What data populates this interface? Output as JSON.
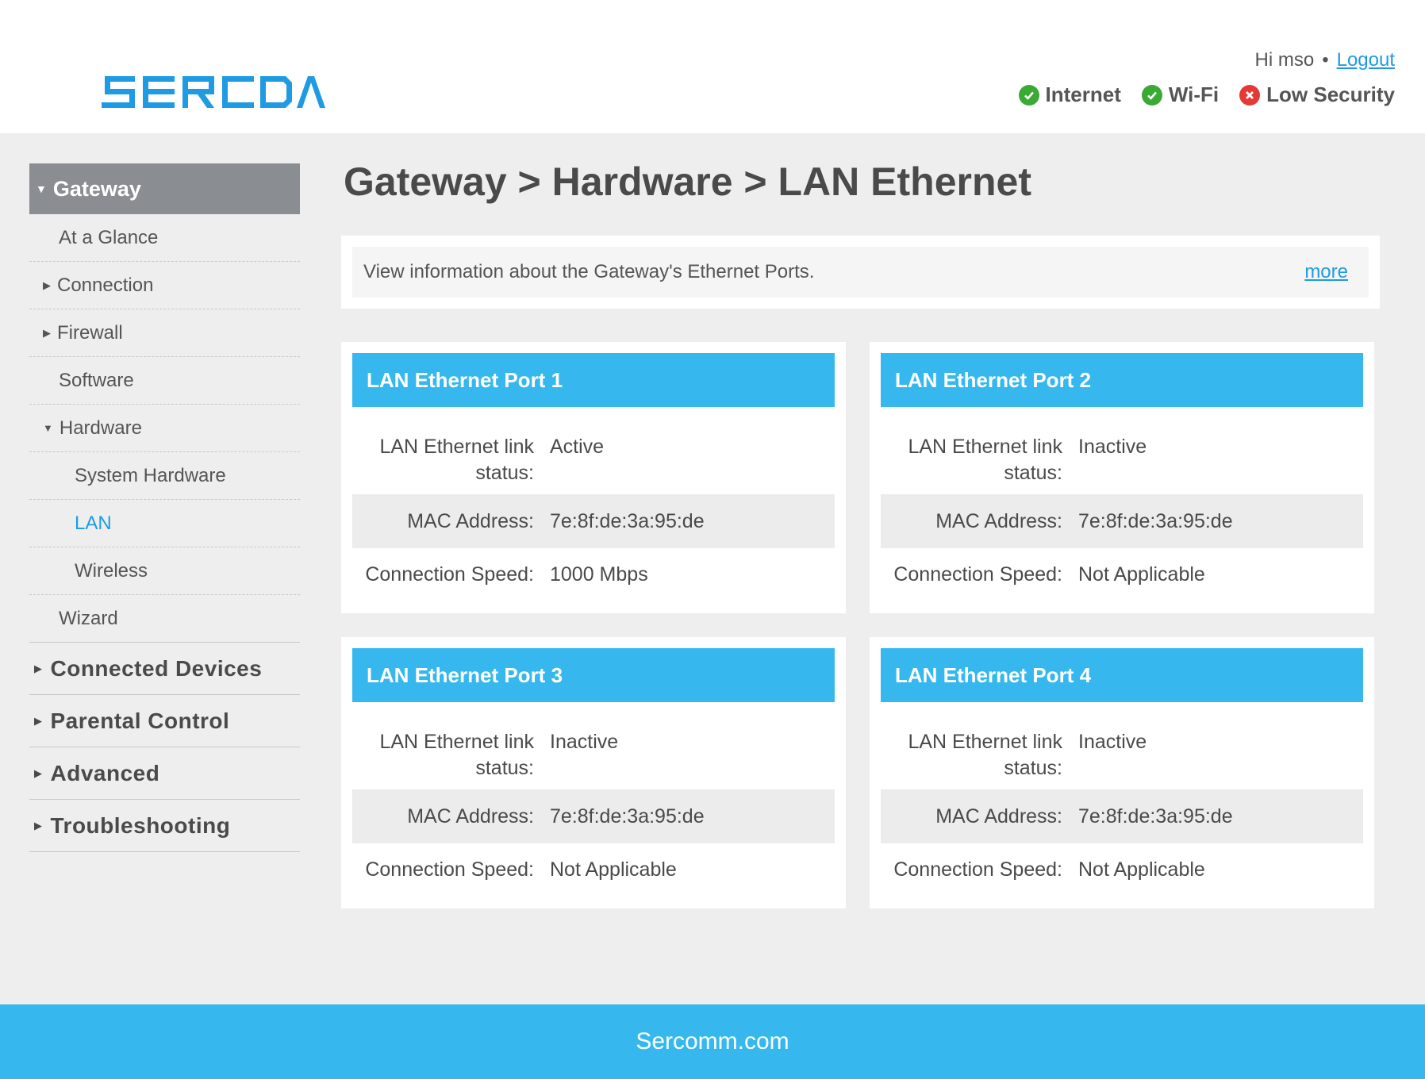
{
  "header": {
    "logo_text": "SERCOMM",
    "greeting": "Hi mso",
    "logout": "Logout",
    "status": [
      {
        "label": "Internet",
        "state": "ok"
      },
      {
        "label": "Wi-Fi",
        "state": "ok"
      },
      {
        "label": "Low Security",
        "state": "error"
      }
    ],
    "colors": {
      "ok": "#3aaa35",
      "error": "#e53935",
      "brand": "#1e9be2"
    }
  },
  "sidebar": {
    "section": "Gateway",
    "items": [
      {
        "label": "At a Glance"
      },
      {
        "label": "Connection"
      },
      {
        "label": "Firewall"
      },
      {
        "label": "Software"
      },
      {
        "label": "Hardware"
      },
      {
        "label": "System Hardware"
      },
      {
        "label": "LAN"
      },
      {
        "label": "Wireless"
      },
      {
        "label": "Wizard"
      }
    ],
    "top_items": [
      "Connected Devices",
      "Parental Control",
      "Advanced",
      "Troubleshooting"
    ]
  },
  "main": {
    "title": "Gateway > Hardware > LAN Ethernet",
    "info": "View information about the Gateway's Ethernet Ports.",
    "more": "more",
    "labels": {
      "link_status": "LAN Ethernet link status:",
      "mac": "MAC Address:",
      "speed": "Connection Speed:"
    },
    "ports": [
      {
        "title": "LAN Ethernet Port 1",
        "link_status": "Active",
        "mac": "7e:8f:de:3a:95:de",
        "speed": "1000 Mbps"
      },
      {
        "title": "LAN Ethernet Port 2",
        "link_status": "Inactive",
        "mac": "7e:8f:de:3a:95:de",
        "speed": "Not Applicable"
      },
      {
        "title": "LAN Ethernet Port 3",
        "link_status": "Inactive",
        "mac": "7e:8f:de:3a:95:de",
        "speed": "Not Applicable"
      },
      {
        "title": "LAN Ethernet Port 4",
        "link_status": "Inactive",
        "mac": "7e:8f:de:3a:95:de",
        "speed": "Not Applicable"
      }
    ]
  },
  "footer": {
    "text": "Sercomm.com"
  }
}
